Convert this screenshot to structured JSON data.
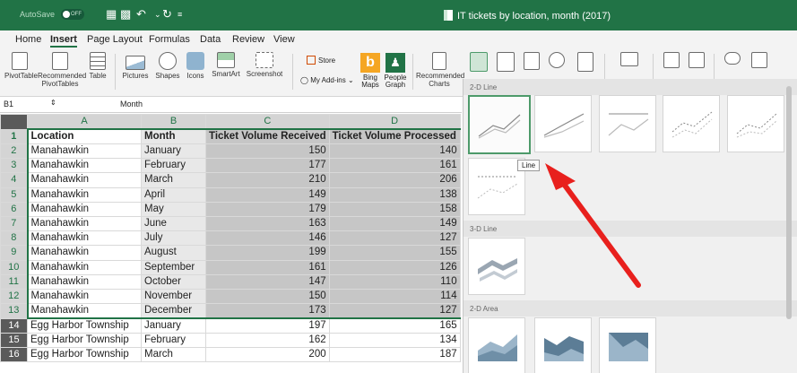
{
  "title_bar": {
    "autosave_label": "AutoSave",
    "autosave_state": "OFF",
    "document_title": "IT tickets by location, month (2017)"
  },
  "ribbon_tabs": [
    "Home",
    "Insert",
    "Page Layout",
    "Formulas",
    "Data",
    "Review",
    "View"
  ],
  "active_tab": "Insert",
  "ribbon": {
    "pivot_table": "PivotTable",
    "recommended_pivot": "Recommended PivotTables",
    "table": "Table",
    "pictures": "Pictures",
    "shapes": "Shapes",
    "icons": "Icons",
    "smartart": "SmartArt",
    "screenshot": "Screenshot",
    "store": "Store",
    "my_addins": "My Add-ins",
    "bing_maps": "Bing Maps",
    "people_graph": "People Graph",
    "recommended_charts": "Recommended Charts"
  },
  "formula_bar": {
    "name_box": "B1",
    "value": "Month"
  },
  "grid": {
    "columns": [
      "A",
      "B",
      "C",
      "D"
    ],
    "rows": [
      {
        "n": "1",
        "cells": [
          "Location",
          "Month",
          "Ticket Volume Received",
          "Ticket Volume Processed"
        ]
      },
      {
        "n": "2",
        "cells": [
          "Manahawkin",
          "January",
          "150",
          "140"
        ]
      },
      {
        "n": "3",
        "cells": [
          "Manahawkin",
          "February",
          "177",
          "161"
        ]
      },
      {
        "n": "4",
        "cells": [
          "Manahawkin",
          "March",
          "210",
          "206"
        ]
      },
      {
        "n": "5",
        "cells": [
          "Manahawkin",
          "April",
          "149",
          "138"
        ]
      },
      {
        "n": "6",
        "cells": [
          "Manahawkin",
          "May",
          "179",
          "158"
        ]
      },
      {
        "n": "7",
        "cells": [
          "Manahawkin",
          "June",
          "163",
          "149"
        ]
      },
      {
        "n": "8",
        "cells": [
          "Manahawkin",
          "July",
          "146",
          "127"
        ]
      },
      {
        "n": "9",
        "cells": [
          "Manahawkin",
          "August",
          "199",
          "155"
        ]
      },
      {
        "n": "10",
        "cells": [
          "Manahawkin",
          "September",
          "161",
          "126"
        ]
      },
      {
        "n": "11",
        "cells": [
          "Manahawkin",
          "October",
          "147",
          "110"
        ]
      },
      {
        "n": "12",
        "cells": [
          "Manahawkin",
          "November",
          "150",
          "114"
        ]
      },
      {
        "n": "13",
        "cells": [
          "Manahawkin",
          "December",
          "173",
          "127"
        ]
      },
      {
        "n": "14",
        "cells": [
          "Egg Harbor Township",
          "January",
          "197",
          "165"
        ]
      },
      {
        "n": "15",
        "cells": [
          "Egg Harbor Township",
          "February",
          "162",
          "134"
        ]
      },
      {
        "n": "16",
        "cells": [
          "Egg Harbor Township",
          "March",
          "200",
          "187"
        ]
      }
    ]
  },
  "gallery": {
    "sections": [
      "2-D Line",
      "3-D Line",
      "2-D Area"
    ],
    "tooltip": "Line",
    "accent_color": "#4d9a6a",
    "arrow_color": "#e8201d"
  }
}
